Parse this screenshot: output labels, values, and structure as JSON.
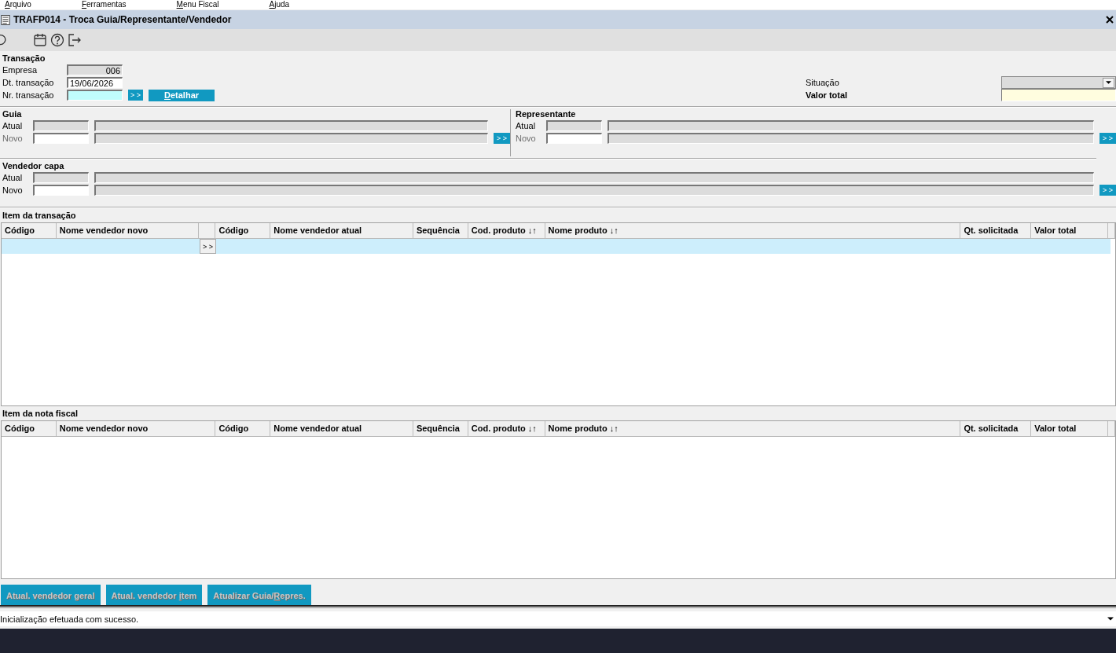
{
  "menu": [
    {
      "label": "Arquivo"
    },
    {
      "label": "Ferramentas"
    },
    {
      "label": "Menu Fiscal"
    },
    {
      "label": "Ajuda"
    }
  ],
  "window": {
    "title": "TRAFP014 - Troca Guia/Representante/Vendedor"
  },
  "transacao": {
    "title": "Transação",
    "fields": [
      {
        "label": "Empresa",
        "value": "006",
        "kind": "readonly"
      },
      {
        "label": "Dt. transação",
        "value": "19/06/2026",
        "kind": "input"
      },
      {
        "label": "Nr. transação",
        "kind": "required"
      }
    ],
    "lookup_button": "> >",
    "detail_button": {
      "label": "Detalhar"
    }
  },
  "situacao": {
    "label": "Situação"
  },
  "valor_total": {
    "label": "Valor total"
  },
  "guia": {
    "title": "Guia",
    "rows": [
      {
        "label": "Atual",
        "disabled": false,
        "editable": false
      },
      {
        "label": "Novo",
        "disabled": true,
        "editable": true
      }
    ],
    "button": "> >"
  },
  "representante": {
    "title": "Representante",
    "rows": [
      {
        "label": "Atual",
        "disabled": false,
        "editable": false
      },
      {
        "label": "Novo",
        "disabled": true,
        "editable": true
      }
    ],
    "button": "> >"
  },
  "vendedor_capa": {
    "title": "Vendedor capa",
    "rows": [
      {
        "label": "Atual",
        "disabled": false,
        "editable": false
      },
      {
        "label": "Novo",
        "disabled": false,
        "editable": true
      }
    ],
    "button": "> >"
  },
  "itens_transacao": {
    "title": "Item da transação",
    "columns": [
      {
        "label": "Código"
      },
      {
        "label": "Nome vendedor novo"
      },
      {
        "kind": "action"
      },
      {
        "label": "Código"
      },
      {
        "label": "Nome vendedor atual"
      },
      {
        "label": "Sequência"
      },
      {
        "label": "Cod. produto ↓↑"
      },
      {
        "label": "Nome produto ↓↑"
      },
      {
        "label": "Qt. solicitada"
      },
      {
        "label": "Valor total"
      }
    ],
    "rows": [
      {
        "selected": true,
        "button": "> >"
      }
    ]
  },
  "itens_nota_fiscal": {
    "title": "Item da nota fiscal",
    "columns": [
      {
        "label": "Código"
      },
      {
        "label": "Nome vendedor novo"
      },
      {
        "label": "Código"
      },
      {
        "label": "Nome vendedor atual"
      },
      {
        "label": "Sequência"
      },
      {
        "label": "Cod. produto ↓↑"
      },
      {
        "label": "Nome produto ↓↑"
      },
      {
        "label": "Qt. solicitada"
      },
      {
        "label": "Valor total"
      }
    ]
  },
  "actions": [
    {
      "label": "Atual. vendedor geral",
      "disabled": true
    },
    {
      "label": "Atual. vendedor item",
      "disabled": true
    },
    {
      "label": "Atualizar Guia/Repres.",
      "disabled": true
    }
  ],
  "status_bar": {
    "message": "Inicialização efetuada com sucesso."
  }
}
